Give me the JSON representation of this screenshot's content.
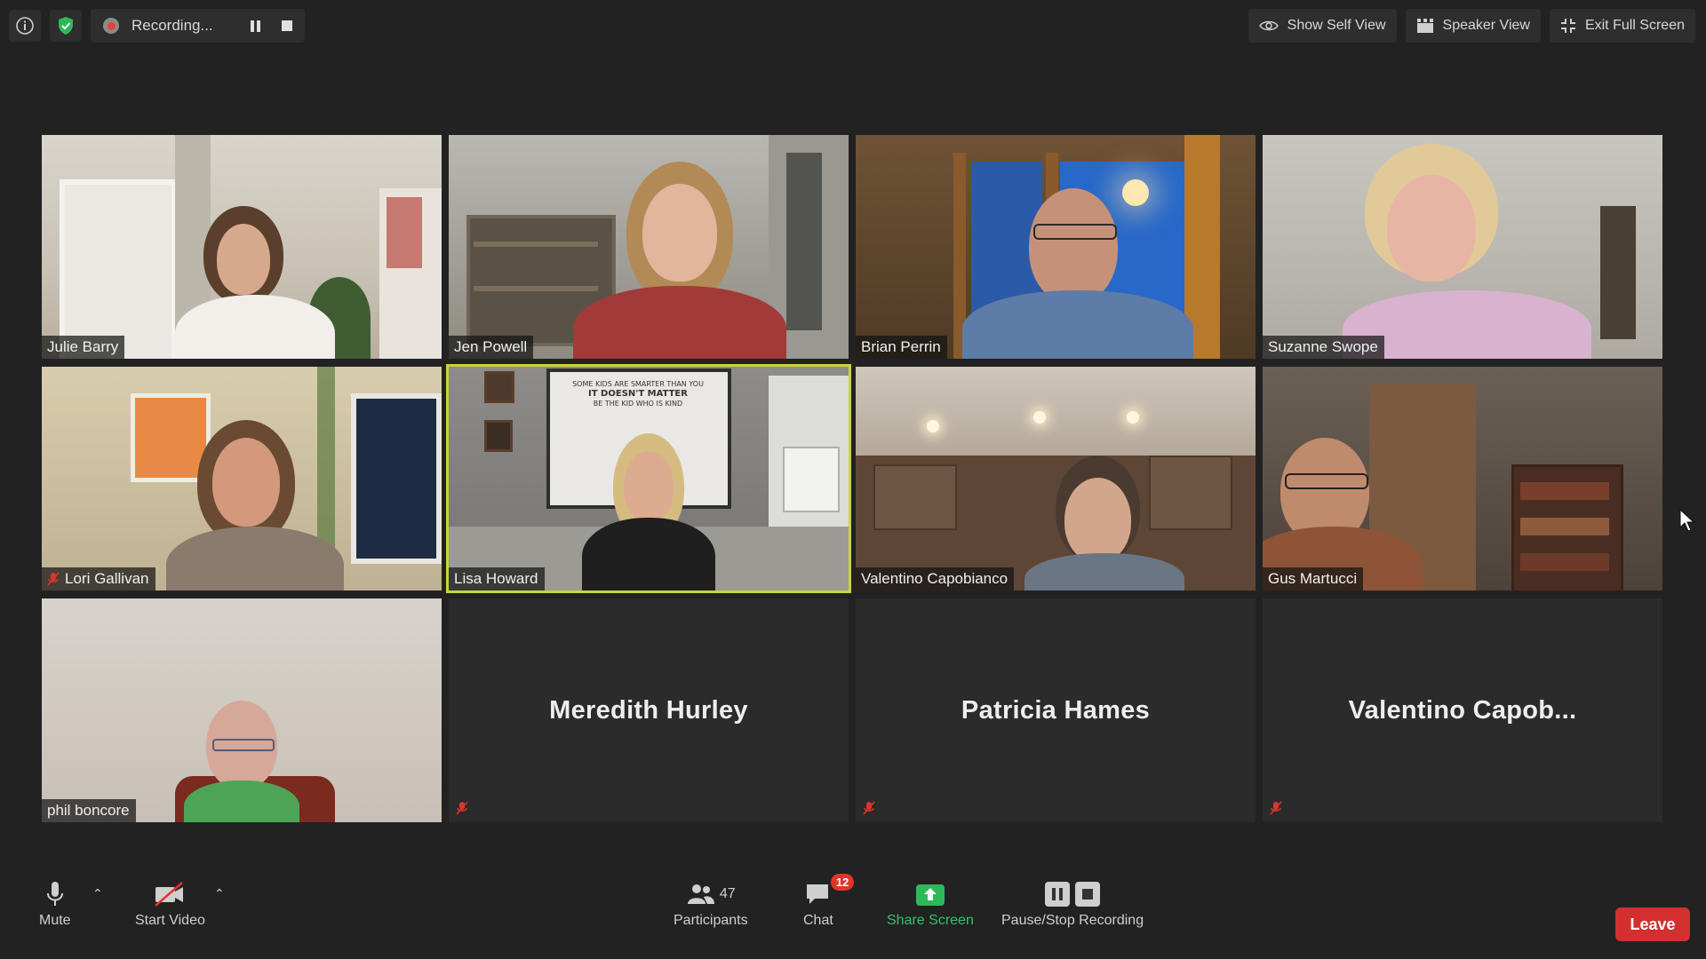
{
  "topbar": {
    "recording_label": "Recording...",
    "show_self_view": "Show Self View",
    "speaker_view": "Speaker View",
    "exit_full_screen": "Exit Full Screen"
  },
  "participants_grid": [
    {
      "name": "Julie Barry",
      "video": true,
      "muted": false
    },
    {
      "name": "Jen Powell",
      "video": true,
      "muted": false
    },
    {
      "name": "Brian Perrin",
      "video": true,
      "muted": false
    },
    {
      "name": "Suzanne Swope",
      "video": true,
      "muted": false
    },
    {
      "name": "Lori Gallivan",
      "video": true,
      "muted": true
    },
    {
      "name": "Lisa Howard",
      "video": true,
      "muted": false,
      "active_speaker": true
    },
    {
      "name": "Valentino Capobianco",
      "video": true,
      "muted": false
    },
    {
      "name": "Gus Martucci",
      "video": true,
      "muted": false
    },
    {
      "name": "phil boncore",
      "video": true,
      "muted": false
    },
    {
      "name": "Meredith Hurley",
      "video": false,
      "muted": true
    },
    {
      "name": "Patricia Hames",
      "video": false,
      "muted": true
    },
    {
      "name": "Valentino  Capob...",
      "video": false,
      "muted": true
    }
  ],
  "whiteboard_text": [
    "SOME KIDS ARE SMARTER THAN YOU",
    "IT DOESN'T MATTER",
    "BE THE KID WHO IS KIND"
  ],
  "toolbar": {
    "mute_label": "Mute",
    "start_video_label": "Start Video",
    "participants_label": "Participants",
    "participants_count": "47",
    "chat_label": "Chat",
    "chat_badge": "12",
    "share_screen_label": "Share Screen",
    "recording_label": "Pause/Stop Recording",
    "leave_label": "Leave"
  },
  "colors": {
    "background": "#222222",
    "active_speaker_border": "#c9d53a",
    "share_green": "#33c46b",
    "leave_red": "#d32f2f",
    "badge_red": "#e0342a"
  }
}
